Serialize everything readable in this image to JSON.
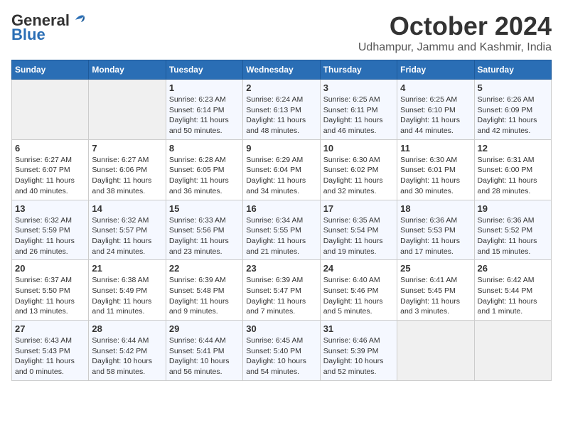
{
  "header": {
    "logo_general": "General",
    "logo_blue": "Blue",
    "month": "October 2024",
    "location": "Udhampur, Jammu and Kashmir, India"
  },
  "weekdays": [
    "Sunday",
    "Monday",
    "Tuesday",
    "Wednesday",
    "Thursday",
    "Friday",
    "Saturday"
  ],
  "weeks": [
    [
      {
        "day": "",
        "text": ""
      },
      {
        "day": "",
        "text": ""
      },
      {
        "day": "1",
        "text": "Sunrise: 6:23 AM\nSunset: 6:14 PM\nDaylight: 11 hours and 50 minutes."
      },
      {
        "day": "2",
        "text": "Sunrise: 6:24 AM\nSunset: 6:13 PM\nDaylight: 11 hours and 48 minutes."
      },
      {
        "day": "3",
        "text": "Sunrise: 6:25 AM\nSunset: 6:11 PM\nDaylight: 11 hours and 46 minutes."
      },
      {
        "day": "4",
        "text": "Sunrise: 6:25 AM\nSunset: 6:10 PM\nDaylight: 11 hours and 44 minutes."
      },
      {
        "day": "5",
        "text": "Sunrise: 6:26 AM\nSunset: 6:09 PM\nDaylight: 11 hours and 42 minutes."
      }
    ],
    [
      {
        "day": "6",
        "text": "Sunrise: 6:27 AM\nSunset: 6:07 PM\nDaylight: 11 hours and 40 minutes."
      },
      {
        "day": "7",
        "text": "Sunrise: 6:27 AM\nSunset: 6:06 PM\nDaylight: 11 hours and 38 minutes."
      },
      {
        "day": "8",
        "text": "Sunrise: 6:28 AM\nSunset: 6:05 PM\nDaylight: 11 hours and 36 minutes."
      },
      {
        "day": "9",
        "text": "Sunrise: 6:29 AM\nSunset: 6:04 PM\nDaylight: 11 hours and 34 minutes."
      },
      {
        "day": "10",
        "text": "Sunrise: 6:30 AM\nSunset: 6:02 PM\nDaylight: 11 hours and 32 minutes."
      },
      {
        "day": "11",
        "text": "Sunrise: 6:30 AM\nSunset: 6:01 PM\nDaylight: 11 hours and 30 minutes."
      },
      {
        "day": "12",
        "text": "Sunrise: 6:31 AM\nSunset: 6:00 PM\nDaylight: 11 hours and 28 minutes."
      }
    ],
    [
      {
        "day": "13",
        "text": "Sunrise: 6:32 AM\nSunset: 5:59 PM\nDaylight: 11 hours and 26 minutes."
      },
      {
        "day": "14",
        "text": "Sunrise: 6:32 AM\nSunset: 5:57 PM\nDaylight: 11 hours and 24 minutes."
      },
      {
        "day": "15",
        "text": "Sunrise: 6:33 AM\nSunset: 5:56 PM\nDaylight: 11 hours and 23 minutes."
      },
      {
        "day": "16",
        "text": "Sunrise: 6:34 AM\nSunset: 5:55 PM\nDaylight: 11 hours and 21 minutes."
      },
      {
        "day": "17",
        "text": "Sunrise: 6:35 AM\nSunset: 5:54 PM\nDaylight: 11 hours and 19 minutes."
      },
      {
        "day": "18",
        "text": "Sunrise: 6:36 AM\nSunset: 5:53 PM\nDaylight: 11 hours and 17 minutes."
      },
      {
        "day": "19",
        "text": "Sunrise: 6:36 AM\nSunset: 5:52 PM\nDaylight: 11 hours and 15 minutes."
      }
    ],
    [
      {
        "day": "20",
        "text": "Sunrise: 6:37 AM\nSunset: 5:50 PM\nDaylight: 11 hours and 13 minutes."
      },
      {
        "day": "21",
        "text": "Sunrise: 6:38 AM\nSunset: 5:49 PM\nDaylight: 11 hours and 11 minutes."
      },
      {
        "day": "22",
        "text": "Sunrise: 6:39 AM\nSunset: 5:48 PM\nDaylight: 11 hours and 9 minutes."
      },
      {
        "day": "23",
        "text": "Sunrise: 6:39 AM\nSunset: 5:47 PM\nDaylight: 11 hours and 7 minutes."
      },
      {
        "day": "24",
        "text": "Sunrise: 6:40 AM\nSunset: 5:46 PM\nDaylight: 11 hours and 5 minutes."
      },
      {
        "day": "25",
        "text": "Sunrise: 6:41 AM\nSunset: 5:45 PM\nDaylight: 11 hours and 3 minutes."
      },
      {
        "day": "26",
        "text": "Sunrise: 6:42 AM\nSunset: 5:44 PM\nDaylight: 11 hours and 1 minute."
      }
    ],
    [
      {
        "day": "27",
        "text": "Sunrise: 6:43 AM\nSunset: 5:43 PM\nDaylight: 11 hours and 0 minutes."
      },
      {
        "day": "28",
        "text": "Sunrise: 6:44 AM\nSunset: 5:42 PM\nDaylight: 10 hours and 58 minutes."
      },
      {
        "day": "29",
        "text": "Sunrise: 6:44 AM\nSunset: 5:41 PM\nDaylight: 10 hours and 56 minutes."
      },
      {
        "day": "30",
        "text": "Sunrise: 6:45 AM\nSunset: 5:40 PM\nDaylight: 10 hours and 54 minutes."
      },
      {
        "day": "31",
        "text": "Sunrise: 6:46 AM\nSunset: 5:39 PM\nDaylight: 10 hours and 52 minutes."
      },
      {
        "day": "",
        "text": ""
      },
      {
        "day": "",
        "text": ""
      }
    ]
  ]
}
